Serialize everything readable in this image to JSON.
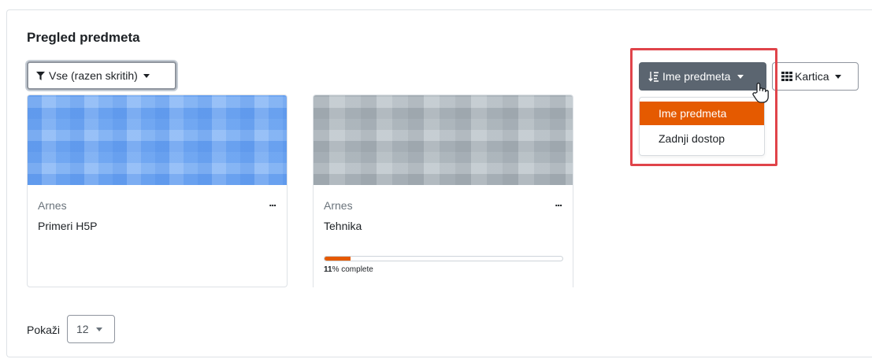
{
  "block": {
    "title": "Pregled predmeta"
  },
  "filter": {
    "label": "Vse (razen skritih)",
    "icon": "filter-icon"
  },
  "sort": {
    "label": "Ime predmeta",
    "icon": "sort-alpha-icon",
    "options": [
      "Ime predmeta",
      "Zadnji dostop"
    ],
    "selected": "Ime predmeta"
  },
  "view": {
    "label": "Kartica",
    "icon": "grid-icon"
  },
  "courses": [
    {
      "category": "Arnes",
      "name": "Primeri H5P",
      "image_color": "#7cb0f5"
    },
    {
      "category": "Arnes",
      "name": "Tehnika",
      "image_color": "#b8c1c7",
      "progress_value": "11",
      "progress_suffix": "% complete",
      "progress_fraction": 0.11
    }
  ],
  "card_menu_label": "...",
  "paging": {
    "show_label": "Pokaži",
    "per_page": "12"
  },
  "colors": {
    "accent": "#e55a00",
    "highlight": "#e0444a",
    "sort_button": "#5b6570"
  }
}
